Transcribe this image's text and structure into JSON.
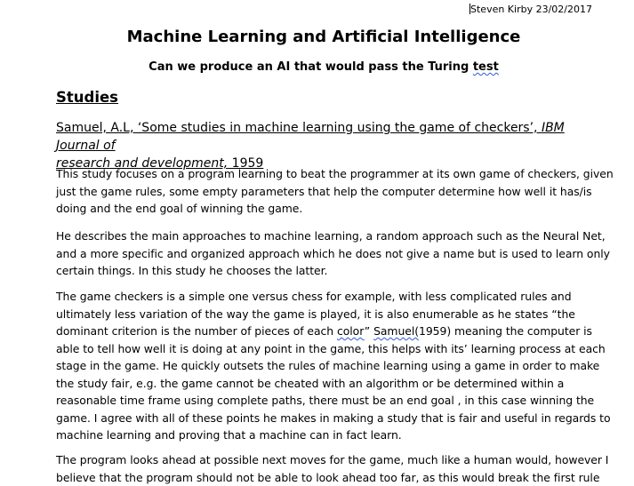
{
  "header": {
    "author_date": "Steven Kirby 23/02/2017"
  },
  "document": {
    "title": "Machine Learning and Artificial Intelligence",
    "subtitle_prefix": "Can we produce an AI that would pass the Turing ",
    "subtitle_spell": "test",
    "section_heading": "Studies",
    "reference": {
      "part1": "Samuel, A.L, ‘Some studies in machine learning using the game of checkers’, ",
      "journal_line1": "IBM Journal of",
      "journal_line2": "research and development,",
      "year": " 1959"
    },
    "paragraph1": {
      "line1": "This study focuses on a program learning to beat the programmer at its own game of checkers, given",
      "line2": "just the game rules, some empty parameters that help the computer determine how well it has/is",
      "line3": "doing and the end goal of winning the game."
    },
    "paragraph2": {
      "line1": "He describes the main approaches to machine learning, a random approach such as the Neural Net,",
      "line2": "and a more specific and organized approach which he does not give a name but is used to learn only",
      "line3": "certain things. In this study he chooses the latter."
    },
    "paragraph3": {
      "line1": "The game checkers is a simple one versus chess for example, with less complicated rules and",
      "line2": "ultimately less variation of the way the game is played, it is also enumerable as he states “the",
      "line3_a": "dominant criterion is the number of pieces of each ",
      "line3_color": "color",
      "line3_b": "” ",
      "line3_samuel": "Samuel(",
      "line3_c": "1959) meaning the computer is",
      "line4": "able to tell how well it is doing at any point in the game, this helps with its’ learning process at each",
      "line5": "stage in the game. He quickly outsets the rules of machine learning using a game in order to make",
      "line6": "the study fair, e.g. the game cannot be cheated with an algorithm or be determined within a",
      "line7": "reasonable time frame using complete paths, there must be an end goal , in this case winning the",
      "line8": "game. I agree with all of these points he makes in making a study that is fair and useful in regards to",
      "line9": "machine learning and proving that a machine can in fact learn."
    },
    "paragraph4": {
      "line1": "The program looks ahead at possible next moves for the game, much like a human would, however I",
      "line2": "believe that the program should not be able to look ahead too far, as this would break the first rule"
    }
  }
}
